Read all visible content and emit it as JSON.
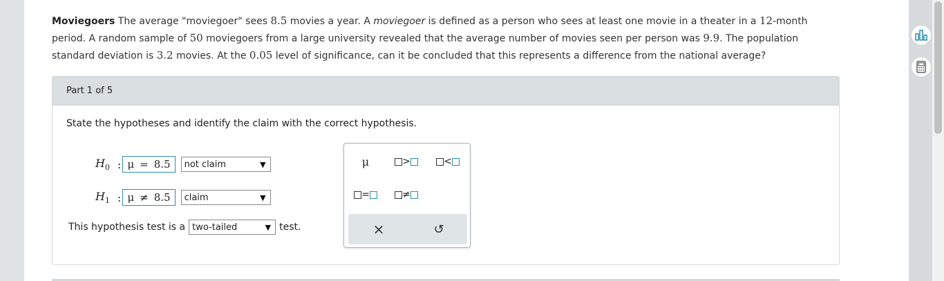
{
  "problem": {
    "title": "Moviegoers",
    "t1": " The average \"moviegoer\" sees ",
    "n1": "8.5",
    "t2": " movies a year. A ",
    "em": "moviegoer",
    "t3": " is defined as a person who sees at least one movie in a theater in a ",
    "n2": "12",
    "t4": "-month period. A random sample of ",
    "n3": "50",
    "t5": " moviegoers from a large university revealed that the average number of movies seen per person was ",
    "n4": "9.9",
    "t6": ". The population standard deviation is ",
    "n5": "3.2",
    "t7": " movies. At the ",
    "n6": "0.05",
    "t8": " level of significance, can it be concluded that this represents a difference from the national average?"
  },
  "part": {
    "header": "Part 1 of 5",
    "instruction": "State the hypotheses and identify the claim with the correct hypothesis."
  },
  "h0": {
    "label": "H",
    "sub": "0",
    "colon": ":",
    "mu": "μ",
    "op": "=",
    "value": "8.5",
    "select_value": "not claim"
  },
  "h1": {
    "label": "H",
    "sub": "1",
    "colon": ":",
    "mu": "μ",
    "op": "≠",
    "value": "8.5",
    "select_value": "claim"
  },
  "test": {
    "prefix": "This hypothesis test is a",
    "select_value": "two-tailed",
    "suffix": "test."
  },
  "palette": {
    "mu": "μ",
    "gt": ">",
    "lt": "<",
    "eq": "=",
    "neq": "≠",
    "clear": "×",
    "undo": "↺"
  },
  "colors": {
    "accent": "#2a8ea6",
    "header_bg": "#d9dee1"
  },
  "icons": {
    "dropdown": "▼",
    "side_top": "bar-chart-icon",
    "side_bottom": "calculator-icon"
  }
}
